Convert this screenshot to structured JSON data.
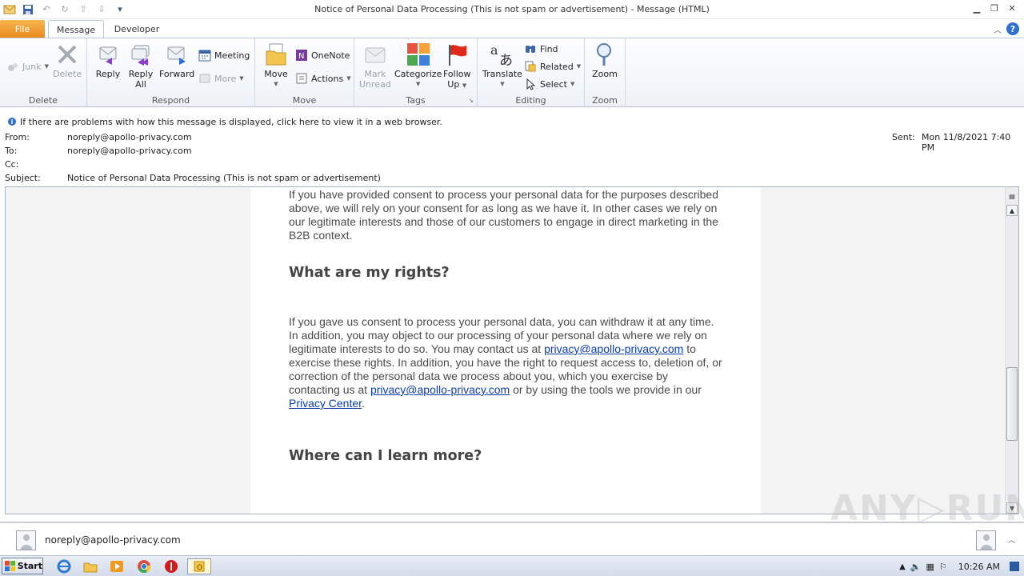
{
  "window": {
    "title": "Notice of Personal Data Processing (This is not spam or advertisement)  -  Message (HTML)"
  },
  "tabs": [
    {
      "label": "File"
    },
    {
      "label": "Message"
    },
    {
      "label": "Developer"
    }
  ],
  "ribbon": {
    "groups": {
      "delete": "Delete",
      "respond": "Respond",
      "move": "Move",
      "tags": "Tags",
      "editing": "Editing",
      "zoom": "Zoom"
    },
    "junk": "Junk",
    "delete_btn": "Delete",
    "reply": "Reply",
    "reply_all_1": "Reply",
    "reply_all_2": "All",
    "forward": "Forward",
    "meeting": "Meeting",
    "more": "More",
    "move_btn": "Move",
    "onenote": "OneNote",
    "actions": "Actions",
    "mark_unread_1": "Mark",
    "mark_unread_2": "Unread",
    "categorize": "Categorize",
    "follow_up_1": "Follow",
    "follow_up_2": "Up",
    "translate": "Translate",
    "find": "Find",
    "related": "Related",
    "select": "Select",
    "zoom_btn": "Zoom"
  },
  "infobar": "If there are problems with how this message is displayed, click here to view it in a web browser.",
  "header": {
    "from_label": "From:",
    "from": "noreply@apollo-privacy.com",
    "to_label": "To:",
    "to": "noreply@apollo-privacy.com",
    "cc_label": "Cc:",
    "subject_label": "Subject:",
    "subject": "Notice of Personal Data Processing (This is not spam or advertisement)",
    "sent_label": "Sent:",
    "sent": "Mon 11/8/2021 7:40 PM"
  },
  "body": {
    "p1_lines": [
      "If you have provided consent to process your personal data for the purposes described",
      "above, we will rely on your consent for as long as we have it. In other cases we rely on",
      "our legitimate interests and those of our customers to engage in direct marketing in the",
      "B2B context."
    ],
    "h_rights": "What are my rights?",
    "p2_l1": "If you gave us consent to process your personal data, you can withdraw it at any time.",
    "p2_l2": "In addition, you may object to our processing of your personal data where we rely on",
    "p2_l3a": "legitimate interests to do so. You may contact us at ",
    "link_email": "privacy@apollo-privacy.com",
    "p2_l3b": " to",
    "p2_l4": "exercise these rights. In addition, you have the right to request access to, deletion of, or",
    "p2_l5": "correction of the personal data we process about you, which you exercise by",
    "p2_l6a": "contacting us at ",
    "p2_l6b": " or by using the tools we provide in our",
    "link_privacy_center": "Privacy Center",
    "p2_end": ".",
    "h_learn": "Where can I learn more?"
  },
  "people_pane": {
    "name": "noreply@apollo-privacy.com"
  },
  "taskbar": {
    "start": "Start",
    "time": "10:26 AM"
  },
  "watermark": "ANY.RUN"
}
